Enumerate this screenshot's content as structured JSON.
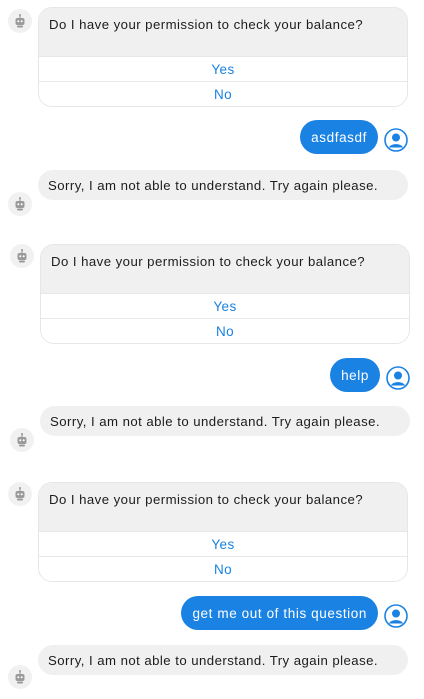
{
  "icons": {
    "bot": "robot-icon",
    "user": "user-avatar-icon"
  },
  "colors": {
    "accent": "#1a82e2",
    "bot_bubble": "#f0f0f0",
    "text": "#1c1c1c"
  },
  "messages": [
    {
      "type": "card",
      "text": "Do I have your permission to check your balance?",
      "options": [
        "Yes",
        "No"
      ]
    },
    {
      "type": "user",
      "text": "asdfasdf"
    },
    {
      "type": "bot",
      "text": "Sorry, I am not able to understand. Try again please."
    },
    {
      "type": "card",
      "text": "Do I have your permission to check your balance?",
      "options": [
        "Yes",
        "No"
      ]
    },
    {
      "type": "user",
      "text": "help"
    },
    {
      "type": "bot",
      "text": "Sorry, I am not able to understand. Try again please."
    },
    {
      "type": "card",
      "text": "Do I have your permission to check your balance?",
      "options": [
        "Yes",
        "No"
      ]
    },
    {
      "type": "user",
      "text": "get me out of this question"
    },
    {
      "type": "bot",
      "text": "Sorry, I am not able to understand. Try again please."
    }
  ]
}
